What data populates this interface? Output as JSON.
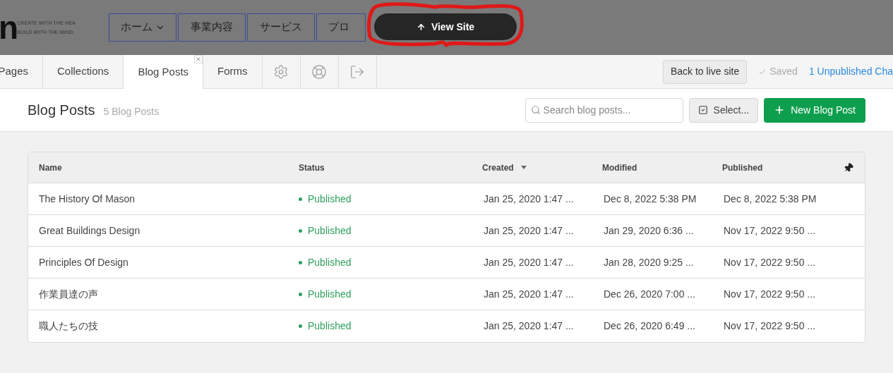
{
  "site_preview": {
    "logo": "n",
    "tagline": [
      "CREATE WITH THE HEA",
      "BUILD WITH THE MIND."
    ],
    "nav": [
      {
        "label": "ホーム",
        "dropdown": true
      },
      {
        "label": "事業内容",
        "dropdown": false
      },
      {
        "label": "サービス",
        "dropdown": false
      },
      {
        "label": "プロ",
        "dropdown": false
      }
    ],
    "view_site_button": "View Site"
  },
  "tabs": [
    {
      "kind": "text",
      "label": "Pages",
      "selected": false
    },
    {
      "kind": "text",
      "label": "Collections",
      "selected": false
    },
    {
      "kind": "text",
      "label": "Blog Posts",
      "selected": true,
      "closable": true
    },
    {
      "kind": "text",
      "label": "Forms",
      "selected": false
    },
    {
      "kind": "settings",
      "selected": false
    },
    {
      "kind": "help",
      "selected": false
    },
    {
      "kind": "exit",
      "selected": false
    }
  ],
  "toolbar": {
    "back_button": "Back to live site",
    "saved": "Saved",
    "unpublished_link": "1 Unpublished Cha"
  },
  "header": {
    "title": "Blog Posts",
    "count": "5 Blog Posts",
    "search": {
      "placeholder": "Search blog posts..."
    },
    "select_button": "Select...",
    "new_button": "New Blog Post"
  },
  "table": {
    "columns": [
      {
        "label": "Name",
        "sorted": false
      },
      {
        "label": "Status",
        "sorted": false
      },
      {
        "label": "Created",
        "sorted": true
      },
      {
        "label": "Modified",
        "sorted": false
      },
      {
        "label": "Published",
        "sorted": false
      }
    ],
    "rows": [
      {
        "name": "The History Of Mason",
        "status": "Published",
        "created": "Jan 25, 2020 1:47 ...",
        "modified": "Dec 8, 2022 5:38 PM",
        "published": "Dec 8, 2022 5:38 PM"
      },
      {
        "name": "Great Buildings Design",
        "status": "Published",
        "created": "Jan 25, 2020 1:47 ...",
        "modified": "Jan 29, 2020 6:36 ...",
        "published": "Nov 17, 2022 9:50 ..."
      },
      {
        "name": "Principles Of Design",
        "status": "Published",
        "created": "Jan 25, 2020 1:47 ...",
        "modified": "Jan 28, 2020 9:25 ...",
        "published": "Nov 17, 2022 9:50 ..."
      },
      {
        "name": "作業員達の声",
        "status": "Published",
        "created": "Jan 25, 2020 1:47 ...",
        "modified": "Dec 26, 2020 7:00 ...",
        "published": "Nov 17, 2022 9:50 ..."
      },
      {
        "name": "職人たちの技",
        "status": "Published",
        "created": "Jan 25, 2020 1:47 ...",
        "modified": "Dec 26, 2020 6:49 ...",
        "published": "Nov 17, 2022 9:50 ..."
      }
    ]
  }
}
